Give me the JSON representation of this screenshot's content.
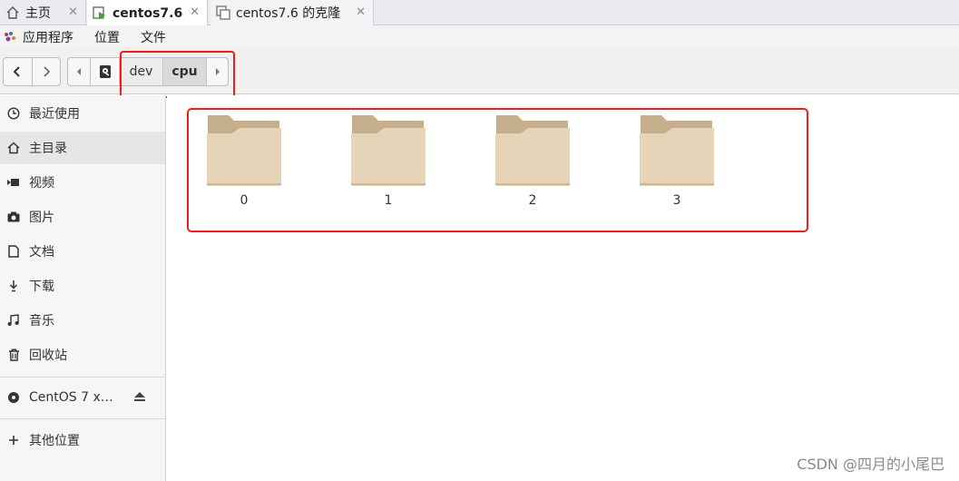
{
  "tabs": [
    {
      "label": "主页"
    },
    {
      "label": "centos7.6"
    },
    {
      "label": "centos7.6 的克隆"
    }
  ],
  "menubar": {
    "items": [
      "应用程序",
      "位置",
      "文件"
    ]
  },
  "path_bar": {
    "segments": [
      "dev",
      "cpu"
    ]
  },
  "sidebar": {
    "items": [
      {
        "label": "最近使用",
        "icon": "clock-icon"
      },
      {
        "label": "主目录",
        "icon": "home-icon"
      },
      {
        "label": "视频",
        "icon": "video-icon"
      },
      {
        "label": "图片",
        "icon": "camera-icon"
      },
      {
        "label": "文档",
        "icon": "document-icon"
      },
      {
        "label": "下载",
        "icon": "download-icon"
      },
      {
        "label": "音乐",
        "icon": "music-icon"
      },
      {
        "label": "回收站",
        "icon": "trash-icon"
      }
    ],
    "device": {
      "label": "CentOS 7 x…",
      "icon": "disc-icon"
    },
    "other": {
      "label": "其他位置",
      "icon": "plus-icon"
    }
  },
  "folders": [
    {
      "name": "0"
    },
    {
      "name": "1"
    },
    {
      "name": "2"
    },
    {
      "name": "3"
    }
  ],
  "watermark": "CSDN @四月的小尾巴",
  "colors": {
    "highlight_box": "#f01c1c",
    "folder_body": "#e6d4b8",
    "folder_tab": "#c4ae8c"
  }
}
